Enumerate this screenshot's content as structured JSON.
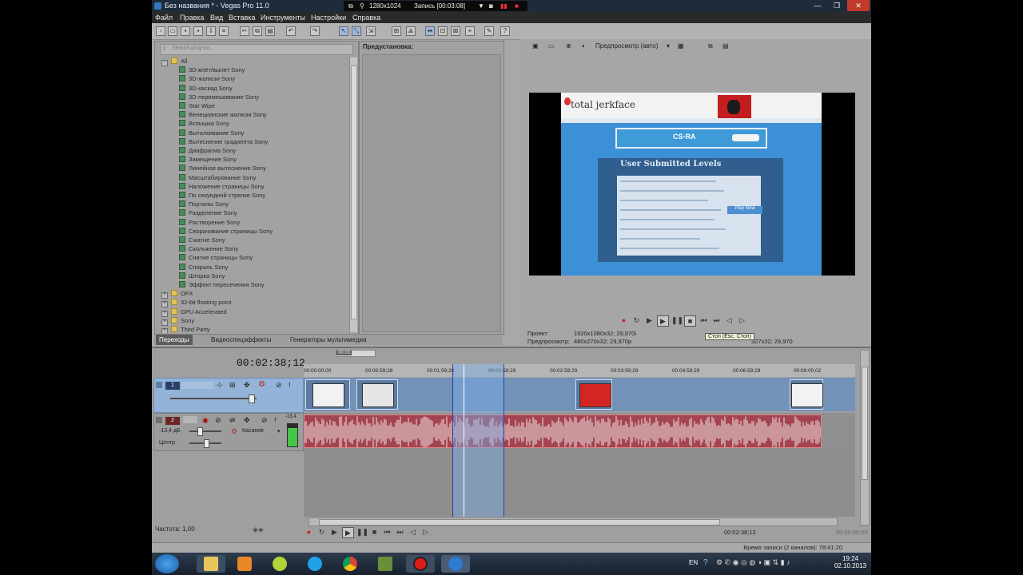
{
  "window": {
    "title": "Без названия * - Vegas Pro 11.0",
    "recorder": {
      "resolution": "1280x1024",
      "recording": "Запись [00:03:08]"
    }
  },
  "menu": [
    "Файл",
    "Правка",
    "Вид",
    "Вставка",
    "Инструменты",
    "Настройки",
    "Справка"
  ],
  "explorer": {
    "search_placeholder": "Search plug-ins",
    "root": "All",
    "transitions": [
      "3D-влёт/вылет Sony",
      "3D-жалюзи Sony",
      "3D-каскад Sony",
      "3D-перемешивание Sony",
      "Star Wipe",
      "Венецианские жалюзи Sony",
      "Вспышка Sony",
      "Выталкивание Sony",
      "Вытеснение градиента Sony",
      "Диафрагма Sony",
      "Замещение Sony",
      "Линейное вытеснение Sony",
      "Масштабирование Sony",
      "Наложение страницы Sony",
      "По секундной стрелке Sony",
      "Порталы Sony",
      "Разделение Sony",
      "Растворение Sony",
      "Сворачивание страницы Sony",
      "Сжатие Sony",
      "Скольжение Sony",
      "Снятие страницы Sony",
      "Спираль Sony",
      "Шторка Sony",
      "Эффект пересечения Sony"
    ],
    "folders": [
      "OFX",
      "32-bit floating point",
      "GPU Accelerated",
      "Sony",
      "Third Party"
    ],
    "preset_label": "Предустановка:"
  },
  "dock_tabs": [
    "Переходы",
    "Видеоспецэффекты",
    "Генераторы мультимедиа"
  ],
  "preview": {
    "mode": "Предпросмотр (авто)",
    "project_label": "Проект:",
    "project_value": "1920x1080x32; 29,970i",
    "preview_label": "Предпросмотр:",
    "preview_value": "480x270x32; 29,970p",
    "display_value": "327x32; 29,970",
    "tooltip": "Стоп (Esc; Стоп)",
    "web": {
      "logo": "total jerkface",
      "ad": "CS-RA",
      "panel_title": "User Submitted Levels",
      "play_button": "Play Now"
    }
  },
  "timeline": {
    "current_time": "00:02:38;12",
    "loop_region_label": "00:03",
    "ruler": [
      "00:00:00;00",
      "00:00:59;28",
      "00:01:59;28",
      "00:02:59;29",
      "00:03:59;29",
      "00:04:59;29",
      "00:05:59;29",
      "00:06:59;29",
      "00:08:00;02"
    ],
    "track1_number": "1",
    "track2_number": "2",
    "track2_volume": "-13,4 дБ",
    "track2_pan": "Центр",
    "track2_mode": "Касание",
    "track2_meter": "-13.4",
    "rate": "Частота: 1,00",
    "cursor_time": "00:02:38;12",
    "end_time": "00:00:50;00",
    "record_status": "Время записи (2 каналов): 78:41:20"
  },
  "taskbar": {
    "lang": "EN",
    "time": "19:24",
    "date": "02.10.2013"
  }
}
